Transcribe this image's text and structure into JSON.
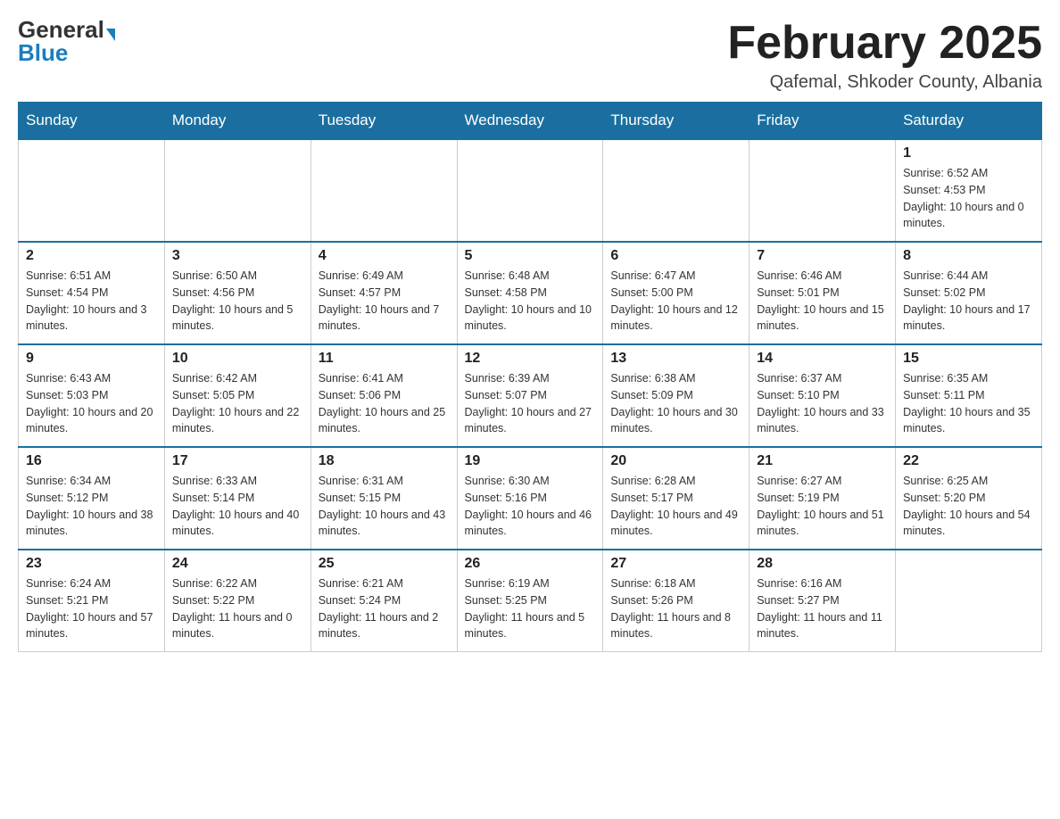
{
  "header": {
    "logo_general": "General",
    "logo_blue": "Blue",
    "month_title": "February 2025",
    "location": "Qafemal, Shkoder County, Albania"
  },
  "days_of_week": [
    "Sunday",
    "Monday",
    "Tuesday",
    "Wednesday",
    "Thursday",
    "Friday",
    "Saturday"
  ],
  "weeks": [
    [
      {
        "day": "",
        "info": ""
      },
      {
        "day": "",
        "info": ""
      },
      {
        "day": "",
        "info": ""
      },
      {
        "day": "",
        "info": ""
      },
      {
        "day": "",
        "info": ""
      },
      {
        "day": "",
        "info": ""
      },
      {
        "day": "1",
        "info": "Sunrise: 6:52 AM\nSunset: 4:53 PM\nDaylight: 10 hours and 0 minutes."
      }
    ],
    [
      {
        "day": "2",
        "info": "Sunrise: 6:51 AM\nSunset: 4:54 PM\nDaylight: 10 hours and 3 minutes."
      },
      {
        "day": "3",
        "info": "Sunrise: 6:50 AM\nSunset: 4:56 PM\nDaylight: 10 hours and 5 minutes."
      },
      {
        "day": "4",
        "info": "Sunrise: 6:49 AM\nSunset: 4:57 PM\nDaylight: 10 hours and 7 minutes."
      },
      {
        "day": "5",
        "info": "Sunrise: 6:48 AM\nSunset: 4:58 PM\nDaylight: 10 hours and 10 minutes."
      },
      {
        "day": "6",
        "info": "Sunrise: 6:47 AM\nSunset: 5:00 PM\nDaylight: 10 hours and 12 minutes."
      },
      {
        "day": "7",
        "info": "Sunrise: 6:46 AM\nSunset: 5:01 PM\nDaylight: 10 hours and 15 minutes."
      },
      {
        "day": "8",
        "info": "Sunrise: 6:44 AM\nSunset: 5:02 PM\nDaylight: 10 hours and 17 minutes."
      }
    ],
    [
      {
        "day": "9",
        "info": "Sunrise: 6:43 AM\nSunset: 5:03 PM\nDaylight: 10 hours and 20 minutes."
      },
      {
        "day": "10",
        "info": "Sunrise: 6:42 AM\nSunset: 5:05 PM\nDaylight: 10 hours and 22 minutes."
      },
      {
        "day": "11",
        "info": "Sunrise: 6:41 AM\nSunset: 5:06 PM\nDaylight: 10 hours and 25 minutes."
      },
      {
        "day": "12",
        "info": "Sunrise: 6:39 AM\nSunset: 5:07 PM\nDaylight: 10 hours and 27 minutes."
      },
      {
        "day": "13",
        "info": "Sunrise: 6:38 AM\nSunset: 5:09 PM\nDaylight: 10 hours and 30 minutes."
      },
      {
        "day": "14",
        "info": "Sunrise: 6:37 AM\nSunset: 5:10 PM\nDaylight: 10 hours and 33 minutes."
      },
      {
        "day": "15",
        "info": "Sunrise: 6:35 AM\nSunset: 5:11 PM\nDaylight: 10 hours and 35 minutes."
      }
    ],
    [
      {
        "day": "16",
        "info": "Sunrise: 6:34 AM\nSunset: 5:12 PM\nDaylight: 10 hours and 38 minutes."
      },
      {
        "day": "17",
        "info": "Sunrise: 6:33 AM\nSunset: 5:14 PM\nDaylight: 10 hours and 40 minutes."
      },
      {
        "day": "18",
        "info": "Sunrise: 6:31 AM\nSunset: 5:15 PM\nDaylight: 10 hours and 43 minutes."
      },
      {
        "day": "19",
        "info": "Sunrise: 6:30 AM\nSunset: 5:16 PM\nDaylight: 10 hours and 46 minutes."
      },
      {
        "day": "20",
        "info": "Sunrise: 6:28 AM\nSunset: 5:17 PM\nDaylight: 10 hours and 49 minutes."
      },
      {
        "day": "21",
        "info": "Sunrise: 6:27 AM\nSunset: 5:19 PM\nDaylight: 10 hours and 51 minutes."
      },
      {
        "day": "22",
        "info": "Sunrise: 6:25 AM\nSunset: 5:20 PM\nDaylight: 10 hours and 54 minutes."
      }
    ],
    [
      {
        "day": "23",
        "info": "Sunrise: 6:24 AM\nSunset: 5:21 PM\nDaylight: 10 hours and 57 minutes."
      },
      {
        "day": "24",
        "info": "Sunrise: 6:22 AM\nSunset: 5:22 PM\nDaylight: 11 hours and 0 minutes."
      },
      {
        "day": "25",
        "info": "Sunrise: 6:21 AM\nSunset: 5:24 PM\nDaylight: 11 hours and 2 minutes."
      },
      {
        "day": "26",
        "info": "Sunrise: 6:19 AM\nSunset: 5:25 PM\nDaylight: 11 hours and 5 minutes."
      },
      {
        "day": "27",
        "info": "Sunrise: 6:18 AM\nSunset: 5:26 PM\nDaylight: 11 hours and 8 minutes."
      },
      {
        "day": "28",
        "info": "Sunrise: 6:16 AM\nSunset: 5:27 PM\nDaylight: 11 hours and 11 minutes."
      },
      {
        "day": "",
        "info": ""
      }
    ]
  ]
}
